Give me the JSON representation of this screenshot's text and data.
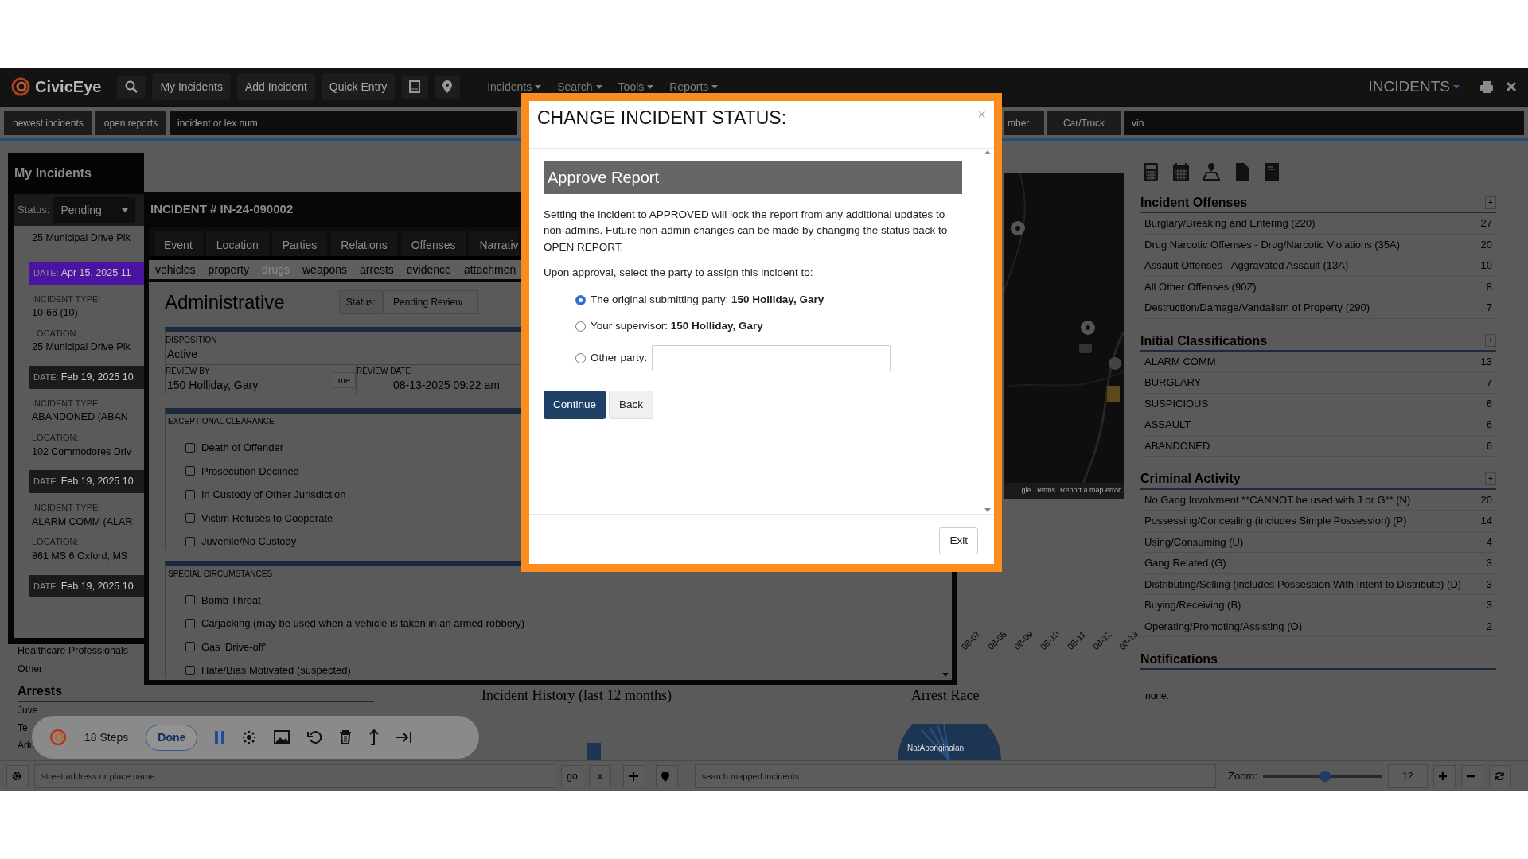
{
  "nav": {
    "logo": "CivicEye",
    "buttons": [
      "My Incidents",
      "Add Incident",
      "Quick Entry"
    ],
    "menus": [
      "Incidents",
      "Search",
      "Tools",
      "Reports"
    ],
    "module": "INCIDENTS"
  },
  "subnav": {
    "buttons": [
      "newest incidents",
      "open reports"
    ],
    "search_placeholder": "incident or lex num",
    "cut_button": "mber",
    "type_button": "Car/Truck",
    "vin_placeholder": "vin"
  },
  "my_incidents": {
    "title": "My Incidents",
    "status_label": "Status:",
    "status_value": "Pending",
    "top_location": "25 Municipal Drive Pik",
    "entries": [
      {
        "date_label": "DATE:",
        "date": "Apr 15, 2025 11",
        "selected": true,
        "type_label": "INCIDENT TYPE:",
        "type": "10-66 (10)",
        "location_label": "LOCATION:",
        "location": "25 Municipal Drive Pik"
      },
      {
        "date_label": "DATE:",
        "date": "Feb 19, 2025 10",
        "selected": false,
        "type_label": "INCIDENT TYPE:",
        "type": "ABANDONED (ABAN",
        "location_label": "LOCATION:",
        "location": "102 Commodores Driv"
      },
      {
        "date_label": "DATE:",
        "date": "Feb 19, 2025 10",
        "selected": false,
        "type_label": "INCIDENT TYPE:",
        "type": "ALARM COMM (ALAR",
        "location_label": "LOCATION:",
        "location": "861 MS 6 Oxford, MS"
      },
      {
        "date_label": "DATE:",
        "date": "Feb 19, 2025 10",
        "selected": false
      }
    ]
  },
  "stats": {
    "rows": [
      "Healthcare Professionals",
      "Other"
    ],
    "arrests_title": "Arrests",
    "arrest_rows": [
      "Juve",
      "Te",
      "Adu"
    ]
  },
  "incident": {
    "title": "INCIDENT # IN-24-090002",
    "tabs": [
      "Event",
      "Location",
      "Parties",
      "Relations",
      "Offenses",
      "Narrativ"
    ],
    "subtabs": [
      {
        "label": "vehicles",
        "disabled": false
      },
      {
        "label": "property",
        "disabled": false
      },
      {
        "label": "drugs",
        "disabled": true
      },
      {
        "label": "weapons",
        "disabled": false
      },
      {
        "label": "arrests",
        "disabled": false
      },
      {
        "label": "evidence",
        "disabled": false
      },
      {
        "label": "attachmen",
        "disabled": false
      }
    ],
    "section_title": "Administrative",
    "status_label": "Status:",
    "status_value": "Pending Review",
    "disposition_label": "DISPOSITION",
    "disposition": "Active",
    "review_by_label": "REVIEW BY",
    "review_by": "150 Holliday, Gary",
    "me_button": "me",
    "review_date_label": "REVIEW DATE",
    "review_date": "08-13-2025 09:22 am",
    "groups": [
      {
        "title": "EXCEPTIONAL CLEARANCE",
        "items": [
          {
            "label": "Death of Offender",
            "checked": false
          },
          {
            "label": "Prosecution Declined",
            "checked": false
          },
          {
            "label": "In Custody of Other Jurisdiction",
            "checked": false
          },
          {
            "label": "Victim Refuses to Cooperate",
            "checked": false
          },
          {
            "label": "Juvenile/No Custody",
            "checked": false
          }
        ]
      },
      {
        "title": "SPECIAL CIRCUMSTANCES",
        "items": [
          {
            "label": "Bomb Threat",
            "checked": false
          },
          {
            "label": "Carjacking (may be used when a vehicle is taken in an armed robbery)",
            "checked": false
          },
          {
            "label": "Gas 'Drive-off'",
            "checked": false
          },
          {
            "label": "Hate/Bias Motivated (suspected)",
            "checked": false
          }
        ]
      }
    ]
  },
  "history": {
    "title": "Incident History (last 12 months)",
    "tick_labels": [
      "08-07",
      "08-08",
      "08-09",
      "08-10",
      "08-11",
      "08-12",
      "08-13"
    ]
  },
  "arrest_race": {
    "title": "Arrest Race",
    "slice_label": "NatAboriginalan"
  },
  "map": {
    "footer": [
      "gle",
      "Terms",
      "Report a map error"
    ]
  },
  "sidebar": {
    "sections": [
      {
        "title": "Incident Offenses",
        "add": "+",
        "rows": [
          {
            "label": "Burglary/Breaking and Entering (220)",
            "count": "27"
          },
          {
            "label": "Drug Narcotic Offenses - Drug/Narcotic Violations (35A)",
            "count": "20"
          },
          {
            "label": "Assault Offenses - Aggravated Assault (13A)",
            "count": "10"
          },
          {
            "label": "All Other Offenses (90Z)",
            "count": "8"
          },
          {
            "label": "Destruction/Damage/Vandalism of Property (290)",
            "count": "7"
          }
        ]
      },
      {
        "title": "Initial Classifications",
        "add": "+",
        "rows": [
          {
            "label": "ALARM COMM",
            "count": "13"
          },
          {
            "label": "BURGLARY",
            "count": "7"
          },
          {
            "label": "SUSPICIOUS",
            "count": "6"
          },
          {
            "label": "ASSAULT",
            "count": "6"
          },
          {
            "label": "ABANDONED",
            "count": "6"
          }
        ]
      },
      {
        "title": "Criminal Activity",
        "add": "+",
        "rows": [
          {
            "label": "No Gang Involvment **CANNOT be used with J or G** (N)",
            "count": "20"
          },
          {
            "label": "Possessing/Concealing (includes Simple Possession) (P)",
            "count": "14"
          },
          {
            "label": "Using/Consuming (U)",
            "count": "4"
          },
          {
            "label": "Gang Related (G)",
            "count": "3"
          },
          {
            "label": "Distributing/Selling (includes Possession With Intent to Distribute) (D)",
            "count": "3"
          },
          {
            "label": "Buying/Receiving (B)",
            "count": "3"
          },
          {
            "label": "Operating/Promoting/Assisting (O)",
            "count": "2"
          }
        ]
      },
      {
        "title": "Notifications",
        "empty": "none."
      }
    ]
  },
  "modal": {
    "title": "CHANGE INCIDENT STATUS:",
    "close": "×",
    "header": "Approve Report",
    "text": "Setting the incident to APPROVED will lock the report from any additional updates to non-admins. Future non-admin changes can be made by changing the status back to OPEN REPORT.",
    "prompt": "Upon approval, select the party to assign this incident to:",
    "options": [
      {
        "label": "The original submitting party: **150 Holliday, Gary**",
        "selected": true
      },
      {
        "label": "Your supervisor: **150 Holliday, Gary**",
        "selected": false
      },
      {
        "label": "Other party:",
        "selected": false,
        "kind": "input"
      }
    ],
    "primary": "Continue",
    "secondary": "Back",
    "exit": "Exit"
  },
  "bottom_bar": {
    "address_placeholder": "street address or place name",
    "go": "go",
    "clear": "x",
    "search_placeholder": "search mapped incidents",
    "zoom_label": "Zoom:",
    "zoom": {
      "level": 0.52
    },
    "zoom_value": "12"
  },
  "recorder": {
    "steps": "18 Steps",
    "done": "Done"
  }
}
